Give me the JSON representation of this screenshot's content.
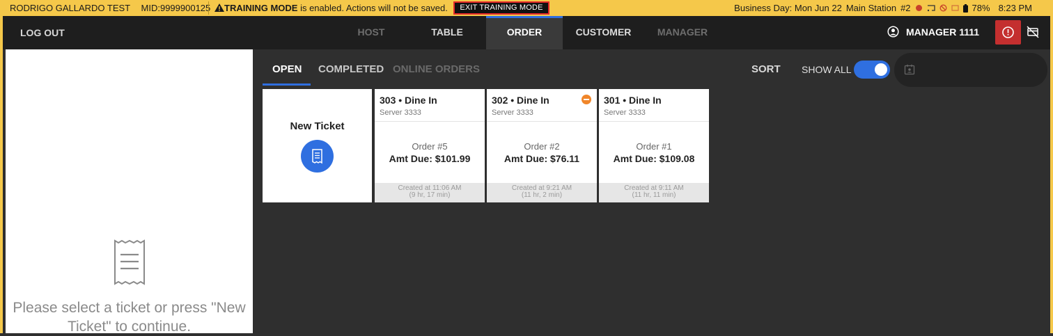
{
  "status_bar": {
    "account": "RODRIGO GALLARDO TEST",
    "mid": "MID:9999900125",
    "training_bold": "TRAINING MODE",
    "training_rest": " is enabled. Actions will not be saved.",
    "exit_training": "EXIT TRAINING MODE",
    "business_day": "Business Day: Mon Jun 22",
    "station": "Main Station",
    "station_num": "#2",
    "battery": "78%",
    "time": "8:23 PM"
  },
  "nav": {
    "logout": "LOG OUT",
    "tabs": [
      {
        "label": "HOST"
      },
      {
        "label": "TABLE"
      },
      {
        "label": "ORDER"
      },
      {
        "label": "CUSTOMER"
      },
      {
        "label": "MANAGER"
      }
    ],
    "user": "MANAGER 1111"
  },
  "left_panel": {
    "message": "Please select a ticket or press \"New Ticket\" to continue."
  },
  "order_tabs": {
    "tabs": [
      {
        "label": "OPEN"
      },
      {
        "label": "COMPLETED"
      },
      {
        "label": "ONLINE ORDERS"
      }
    ],
    "sort": "SORT",
    "show_all": "SHOW ALL",
    "show_all_on": true
  },
  "new_ticket": {
    "label": "New Ticket"
  },
  "tickets": [
    {
      "title": "303 • Dine In",
      "server": "Server 3333",
      "order": "Order #5",
      "amount": "Amt Due: $101.99",
      "created": "Created at 11:06 AM",
      "elapsed": "(9 hr, 17 min)",
      "flagged": false
    },
    {
      "title": "302 • Dine In",
      "server": "Server 3333",
      "order": "Order #2",
      "amount": "Amt Due: $76.11",
      "created": "Created at 9:21 AM",
      "elapsed": "(11 hr, 2 min)",
      "flagged": true
    },
    {
      "title": "301 • Dine In",
      "server": "Server 3333",
      "order": "Order #1",
      "amount": "Amt Due: $109.08",
      "created": "Created at 9:11 AM",
      "elapsed": "(11 hr, 11 min)",
      "flagged": false
    }
  ],
  "colors": {
    "training_bar": "#f5c84a",
    "accent": "#2f6fe0",
    "alert": "#c42f2f",
    "flag": "#f0862a"
  }
}
